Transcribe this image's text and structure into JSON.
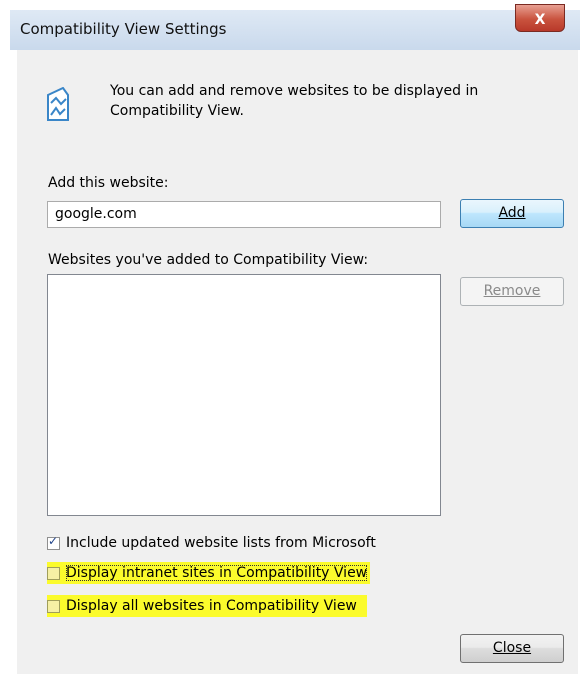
{
  "window": {
    "title": "Compatibility View Settings",
    "close_glyph": "X"
  },
  "info": {
    "icon": "compatibility-view-icon",
    "text": "You can add and remove websites to be displayed in Compatibility View."
  },
  "add_section": {
    "label": "Add this website:",
    "input_value": "google.com",
    "add_button": "Add"
  },
  "list_section": {
    "label": "Websites you've added to Compatibility View:",
    "items": [],
    "remove_button": "Remove"
  },
  "options": [
    {
      "label": "Include updated website lists from Microsoft",
      "checked": true,
      "highlighted": false
    },
    {
      "label": "Display intranet sites in Compatibility View",
      "checked": false,
      "highlighted": true
    },
    {
      "label": "Display all websites in Compatibility View",
      "checked": false,
      "highlighted": true
    }
  ],
  "footer": {
    "close_button": "Close"
  },
  "colors": {
    "highlight": "#fbfb2c",
    "titlebar": "#c9d9ec",
    "dialog_bg": "#f0f0f0",
    "close_red": "#c9533e"
  }
}
